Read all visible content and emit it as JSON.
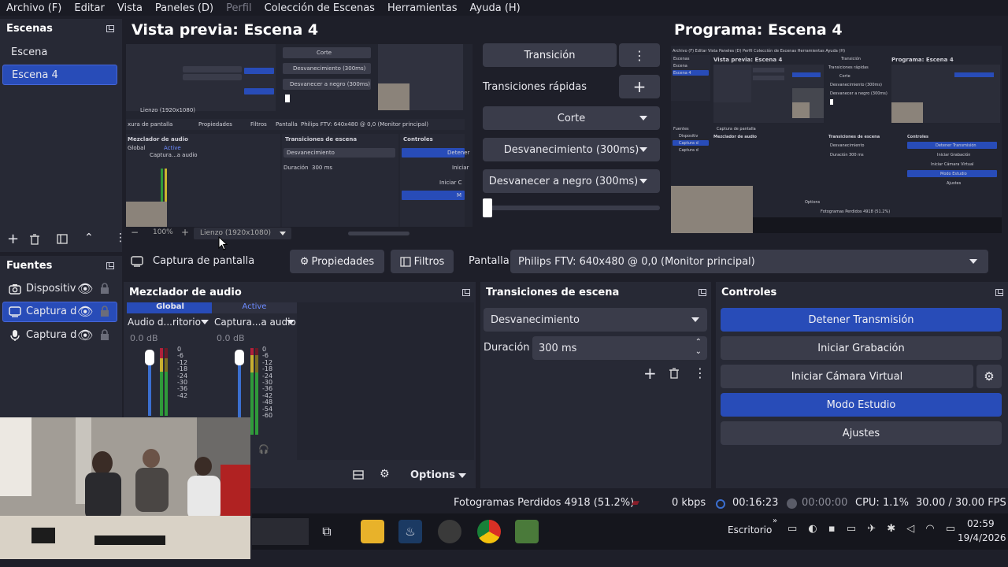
{
  "menu": [
    "Archivo (F)",
    "Editar",
    "Vista",
    "Paneles (D)",
    "Perfil",
    "Colección de Escenas",
    "Herramientas",
    "Ayuda (H)"
  ],
  "scenes": {
    "title": "Escenas",
    "items": [
      "Escena",
      "Escena 4"
    ],
    "selected": 1
  },
  "sources": {
    "title": "Fuentes",
    "items": [
      "Dispositiv",
      "Captura d",
      "Captura d"
    ]
  },
  "preview": {
    "title": "Vista previa: Escena 4",
    "zoom": "100%",
    "canvas": "Lienzo (1920x1080)"
  },
  "program": {
    "title": "Programa: Escena 4"
  },
  "transition_panel": {
    "transition_btn": "Transición",
    "quick_label": "Transiciones rápidas",
    "quick": [
      "Corte",
      "Desvanecimiento (300ms)",
      "Desvanecer a negro (300ms)"
    ],
    "slider_fraction": 0.0
  },
  "source_toolbar": {
    "source_name": "Captura de pantalla",
    "properties": "Propiedades",
    "filters": "Filtros",
    "display_label": "Pantalla",
    "display_value": "Philips FTV: 640x480 @ 0,0 (Monitor principal)"
  },
  "mixer": {
    "title": "Mezclador de audio",
    "tabs": [
      "Global",
      "Active"
    ],
    "channels": [
      {
        "name": "Audio d...ritorio",
        "db": "0.0 dB"
      },
      {
        "name": "Captura...a audio",
        "db": "0.0 dB"
      }
    ],
    "scale": [
      "0",
      "-6",
      "-12",
      "-18",
      "-24",
      "-30",
      "-36",
      "-42",
      "-48",
      "-54",
      "-60"
    ],
    "options": "Options"
  },
  "scene_transitions": {
    "title": "Transiciones de escena",
    "type": "Desvanecimiento",
    "duration_label": "Duración",
    "duration_value": "300 ms"
  },
  "controls": {
    "title": "Controles",
    "buttons": [
      "Detener Transmisión",
      "Iniciar Grabación",
      "Iniciar Cámara Virtual",
      "Modo Estudio",
      "Ajustes"
    ]
  },
  "status": {
    "dropped": "Fotogramas Perdidos 4918 (51.2%)",
    "kbps": "0 kbps",
    "stream_time": "00:16:23",
    "rec_time": "00:00:00",
    "cpu": "CPU: 1.1%",
    "fps": "30.00 / 30.00 FPS"
  },
  "taskbar": {
    "desktop_label": "Escritorio",
    "time": "02:59",
    "date": "19/4/2026"
  },
  "mini": {
    "audio_mixer": "Mezclador de audio",
    "scene_trans": "Transiciones de escena",
    "controls": "Controles",
    "pantalla": "Pantalla",
    "philips": "Philips FTV: 640x480 @ 0,0 (Monitor principal)",
    "properties": "Propiedades",
    "filters": "Filtros",
    "capture": "xura de pantalla",
    "desv": "Desvanecimiento",
    "duracion": "Duración",
    "dur_val": "300 ms",
    "global": "Global",
    "active": "Active",
    "cap_audio": "Captura...a audio",
    "detener": "Detener",
    "iniciar": "Iniciar",
    "iniciar_c": "Iniciar C",
    "m": "M",
    "corte": "Corte",
    "desv300": "Desvanecimiento (300ms)",
    "negro300": "Desvanecer a negro (300ms)",
    "lienzo": "Lienzo (1920x1080)",
    "p_menu": "Archivo (F)  Editar  Vista  Paneles (D)  Perfil  Colección de Escenas  Herramientas  Ayuda (H)",
    "p_escenas": "Escenas",
    "p_escena": "Escena",
    "p_escena4": "Escena 4",
    "p_vista": "Vista previa: Escena 4",
    "p_programa": "Programa: Escena 4",
    "p_transicion": "Transición",
    "p_quick": "Transiciones rápidas",
    "p_fuentes": "Fuentes",
    "p_dispositiv": "Dispositiv",
    "p_captura": "Captura d",
    "p_captura_pantalla": "Captura de pantalla",
    "p_detener": "Detener Transmisión",
    "p_grabacion": "Iniciar Grabación",
    "p_camara": "Iniciar Cámara Virtual",
    "p_modo": "Modo Estudio",
    "p_ajustes": "Ajustes",
    "p_options": "Options",
    "p_fotogramas": "Fotogramas Perdidos 4918 (51.2%)"
  }
}
